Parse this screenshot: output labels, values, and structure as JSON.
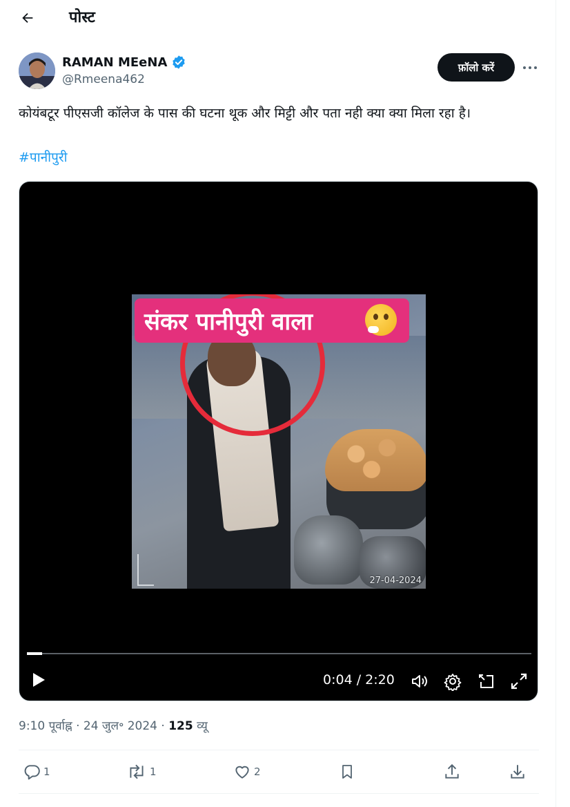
{
  "header": {
    "title": "पोस्ट"
  },
  "author": {
    "name": "RAMAN MEeNA",
    "handle": "@Rmeena462",
    "verified": true
  },
  "follow_label": "फ़ॉलो करें",
  "post": {
    "text": "कोयंबटूर पीएसजी कॉलेज के पास की घटना थूक और मिट्टी और पता नही क्या क्या मिला रहा है।",
    "hashtag": "#पानीपुरी"
  },
  "video": {
    "overlay_text": "संकर पानीपुरी वाला",
    "date_stamp": "27-04-2024",
    "time": "0:04 / 2:20",
    "progress": 0.03
  },
  "meta": {
    "time": "9:10 पूर्वाह्न",
    "date": "24 जुल॰ 2024",
    "views_count": "125",
    "views_label": "व्यू"
  },
  "actions": {
    "replies": "1",
    "reposts": "1",
    "likes": "2"
  },
  "colors": {
    "accent": "#1d9bf0",
    "text": "#0f1419",
    "secondary": "#536471",
    "banner": "#e4307c"
  }
}
